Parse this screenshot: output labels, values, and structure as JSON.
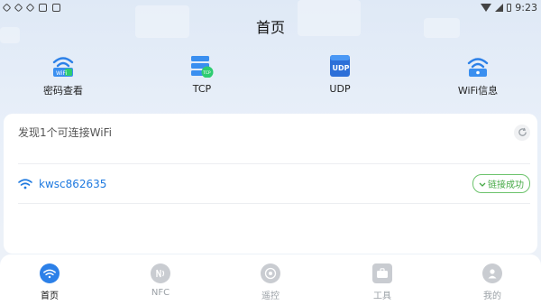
{
  "status_bar": {
    "time": "9:23"
  },
  "header": {
    "title": "首页"
  },
  "quick_actions": [
    {
      "label": "密码查看",
      "icon": "wifi-key-icon"
    },
    {
      "label": "TCP",
      "icon": "tcp-server-icon"
    },
    {
      "label": "UDP",
      "icon": "udp-icon"
    },
    {
      "label": "WiFi信息",
      "icon": "wifi-info-icon"
    }
  ],
  "wifi_card": {
    "found_text": "发现1个可连接WiFi",
    "networks": [
      {
        "ssid": "kwsc862635",
        "status": "链接成功"
      }
    ]
  },
  "tabs": [
    {
      "label": "首页",
      "active": true,
      "icon": "home-wifi-icon"
    },
    {
      "label": "NFC",
      "active": false,
      "icon": "nfc-icon"
    },
    {
      "label": "遥控",
      "active": false,
      "icon": "remote-icon"
    },
    {
      "label": "工具",
      "active": false,
      "icon": "toolbox-icon"
    },
    {
      "label": "我的",
      "active": false,
      "icon": "user-icon"
    }
  ],
  "colors": {
    "accent": "#2c80e8",
    "success": "#46a946",
    "ssid": "#1f7ae0"
  }
}
